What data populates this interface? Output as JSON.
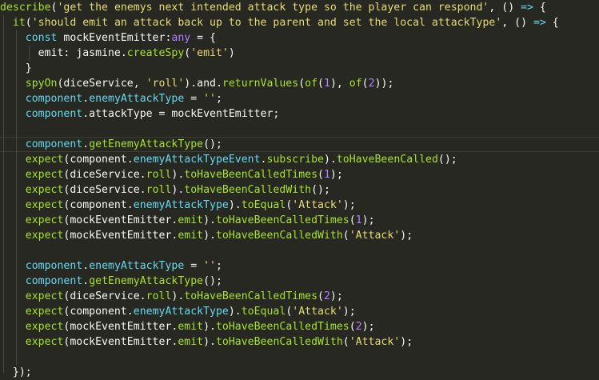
{
  "editor": {
    "lines": [
      [
        [
          "fn",
          "describe"
        ],
        [
          "plain",
          "("
        ],
        [
          "str",
          "'get the enemys next intended attack type so the player can respond'"
        ],
        [
          "plain",
          ", () "
        ],
        [
          "kw",
          "=>"
        ],
        [
          "plain",
          " {"
        ]
      ],
      [
        [
          "plain",
          "  "
        ],
        [
          "fn",
          "it"
        ],
        [
          "plain",
          "("
        ],
        [
          "str",
          "'should emit an attack back up to the parent and set the local attackType'"
        ],
        [
          "plain",
          ", () "
        ],
        [
          "kw",
          "=>"
        ],
        [
          "plain",
          " {"
        ]
      ],
      [
        [
          "plain",
          "    "
        ],
        [
          "kw",
          "const"
        ],
        [
          "plain",
          " mockEventEmitter:"
        ],
        [
          "type",
          "any"
        ],
        [
          "plain",
          " = {"
        ]
      ],
      [
        [
          "plain",
          "      emit: jasmine."
        ],
        [
          "fn",
          "createSpy"
        ],
        [
          "plain",
          "("
        ],
        [
          "str",
          "'emit'"
        ],
        [
          "plain",
          ")"
        ]
      ],
      [
        [
          "plain",
          "    }"
        ]
      ],
      [
        [
          "plain",
          "    "
        ],
        [
          "fn",
          "spyOn"
        ],
        [
          "plain",
          "(diceService, "
        ],
        [
          "str",
          "'roll'"
        ],
        [
          "plain",
          "). and."
        ],
        [
          "fn",
          "returnValues"
        ],
        [
          "plain",
          "("
        ],
        [
          "fn",
          "of"
        ],
        [
          "plain",
          "("
        ],
        [
          "num",
          "1"
        ],
        [
          "plain",
          "), "
        ],
        [
          "fn",
          "of"
        ],
        [
          "plain",
          "("
        ],
        [
          "num",
          "2"
        ],
        [
          "plain",
          "));"
        ]
      ],
      [
        [
          "plain",
          "    "
        ],
        [
          "var",
          "component"
        ],
        [
          "plain",
          "."
        ],
        [
          "var",
          "enemyAttackType"
        ],
        [
          "plain",
          " = "
        ],
        [
          "str",
          "''"
        ],
        [
          "plain",
          ";"
        ]
      ],
      [
        [
          "plain",
          "    "
        ],
        [
          "var",
          "component"
        ],
        [
          "plain",
          ".attackType = mockEventEmitter;"
        ]
      ],
      [],
      [
        [
          "plain",
          "    "
        ],
        [
          "var",
          "component"
        ],
        [
          "plain",
          "."
        ],
        [
          "fn",
          "getEnemyAttackType"
        ],
        [
          "plain",
          "();"
        ]
      ],
      [
        [
          "plain",
          "    "
        ],
        [
          "fn",
          "expect"
        ],
        [
          "plain",
          "(component."
        ],
        [
          "var",
          "enemyAttackTypeEvent"
        ],
        [
          "plain",
          "."
        ],
        [
          "fn",
          "subscribe"
        ],
        [
          "plain",
          "). "
        ],
        [
          "fn",
          "toHaveBeenCalled"
        ],
        [
          "plain",
          "();"
        ]
      ],
      [
        [
          "plain",
          "    "
        ],
        [
          "fn",
          "expect"
        ],
        [
          "plain",
          "(diceService."
        ],
        [
          "fn",
          "roll"
        ],
        [
          "plain",
          "). "
        ],
        [
          "fn",
          "toHaveBeenCalledTimes"
        ],
        [
          "plain",
          "("
        ],
        [
          "num",
          "1"
        ],
        [
          "plain",
          ");"
        ]
      ],
      [
        [
          "plain",
          "    "
        ],
        [
          "fn",
          "expect"
        ],
        [
          "plain",
          "(diceService."
        ],
        [
          "fn",
          "roll"
        ],
        [
          "plain",
          "). "
        ],
        [
          "fn",
          "toHaveBeenCalledWith"
        ],
        [
          "plain",
          "();"
        ]
      ],
      [
        [
          "plain",
          "    "
        ],
        [
          "fn",
          "expect"
        ],
        [
          "plain",
          "(component."
        ],
        [
          "var",
          "enemyAttackType"
        ],
        [
          "plain",
          "). "
        ],
        [
          "fn",
          "toEqual"
        ],
        [
          "plain",
          "("
        ],
        [
          "str",
          "'Attack'"
        ],
        [
          "plain",
          ");"
        ]
      ],
      [
        [
          "plain",
          "    "
        ],
        [
          "fn",
          "expect"
        ],
        [
          "plain",
          "(mockEventEmitter."
        ],
        [
          "fn",
          "emit"
        ],
        [
          "plain",
          "). "
        ],
        [
          "fn",
          "toHaveBeenCalledTimes"
        ],
        [
          "plain",
          "("
        ],
        [
          "num",
          "1"
        ],
        [
          "plain",
          ");"
        ]
      ],
      [
        [
          "plain",
          "    "
        ],
        [
          "fn",
          "expect"
        ],
        [
          "plain",
          "(mockEventEmitter."
        ],
        [
          "fn",
          "emit"
        ],
        [
          "plain",
          "). "
        ],
        [
          "fn",
          "toHaveBeenCalledWith"
        ],
        [
          "plain",
          "("
        ],
        [
          "str",
          "'Attack'"
        ],
        [
          "plain",
          ");"
        ]
      ],
      [],
      [
        [
          "plain",
          "    "
        ],
        [
          "var",
          "component"
        ],
        [
          "plain",
          "."
        ],
        [
          "var",
          "enemyAttackType"
        ],
        [
          "plain",
          " = "
        ],
        [
          "str",
          "''"
        ],
        [
          "plain",
          ";"
        ]
      ],
      [
        [
          "plain",
          "    "
        ],
        [
          "var",
          "component"
        ],
        [
          "plain",
          "."
        ],
        [
          "fn",
          "getEnemyAttackType"
        ],
        [
          "plain",
          "();"
        ]
      ],
      [
        [
          "plain",
          "    "
        ],
        [
          "fn",
          "expect"
        ],
        [
          "plain",
          "(diceService."
        ],
        [
          "fn",
          "roll"
        ],
        [
          "plain",
          "). "
        ],
        [
          "fn",
          "toHaveBeenCalledTimes"
        ],
        [
          "plain",
          "("
        ],
        [
          "num",
          "2"
        ],
        [
          "plain",
          ");"
        ]
      ],
      [
        [
          "plain",
          "    "
        ],
        [
          "fn",
          "expect"
        ],
        [
          "plain",
          "(component."
        ],
        [
          "var",
          "enemyAttackType"
        ],
        [
          "plain",
          "). "
        ],
        [
          "fn",
          "toEqual"
        ],
        [
          "plain",
          "("
        ],
        [
          "str",
          "'Attack'"
        ],
        [
          "plain",
          ");"
        ]
      ],
      [
        [
          "plain",
          "    "
        ],
        [
          "fn",
          "expect"
        ],
        [
          "plain",
          "(mockEventEmitter."
        ],
        [
          "fn",
          "emit"
        ],
        [
          "plain",
          "). "
        ],
        [
          "fn",
          "toHaveBeenCalledTimes"
        ],
        [
          "plain",
          "("
        ],
        [
          "num",
          "2"
        ],
        [
          "plain",
          ");"
        ]
      ],
      [
        [
          "plain",
          "    "
        ],
        [
          "fn",
          "expect"
        ],
        [
          "plain",
          "(mockEventEmitter."
        ],
        [
          "fn",
          "emit"
        ],
        [
          "plain",
          "). "
        ],
        [
          "fn",
          "toHaveBeenCalledWith"
        ],
        [
          "plain",
          "("
        ],
        [
          "str",
          "'Attack'"
        ],
        [
          "plain",
          ");"
        ]
      ],
      [],
      [
        [
          "plain",
          "  });"
        ]
      ]
    ],
    "colors": {
      "background": "#272822",
      "function": "#a6e22e",
      "string": "#e6db74",
      "keyword": "#66d9ef",
      "number": "#ae81ff"
    }
  }
}
